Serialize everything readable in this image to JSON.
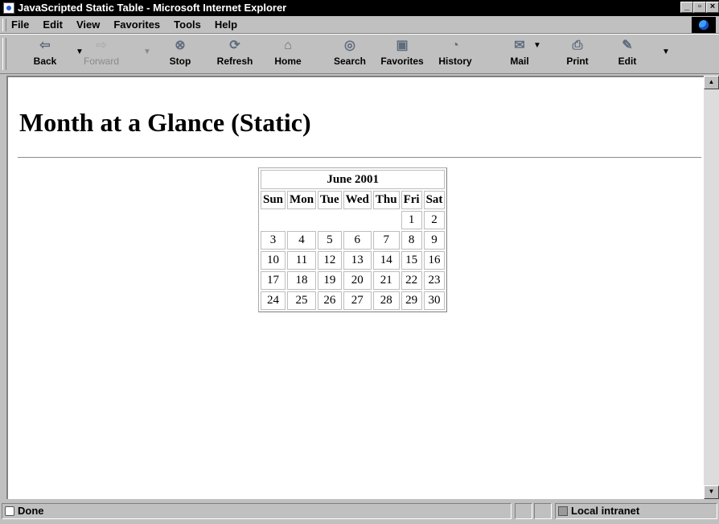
{
  "window": {
    "title": "JavaScripted Static Table - Microsoft Internet Explorer",
    "controls": [
      "_",
      "▫",
      "×"
    ]
  },
  "menu": [
    {
      "label": "File"
    },
    {
      "label": "Edit"
    },
    {
      "label": "View"
    },
    {
      "label": "Favorites"
    },
    {
      "label": "Tools"
    },
    {
      "label": "Help"
    }
  ],
  "toolbar": {
    "buttons": [
      {
        "label": "Back",
        "icon": "back-arrow-icon"
      },
      {
        "label": "Forward",
        "icon": "forward-arrow-icon",
        "disabled": true
      },
      {
        "label": "Stop",
        "icon": "stop-icon"
      },
      {
        "label": "Refresh",
        "icon": "refresh-icon"
      },
      {
        "label": "Home",
        "icon": "home-icon"
      },
      {
        "label": "Search",
        "icon": "search-icon"
      },
      {
        "label": "Favorites",
        "icon": "favorites-icon"
      },
      {
        "label": "History",
        "icon": "history-icon"
      },
      {
        "label": "Mail",
        "icon": "mail-icon"
      },
      {
        "label": "Print",
        "icon": "print-icon"
      },
      {
        "label": "Edit",
        "icon": "edit-icon"
      }
    ]
  },
  "page": {
    "heading": "Month at a Glance (Static)",
    "calendar": {
      "caption": "June 2001",
      "days": [
        "Sun",
        "Mon",
        "Tue",
        "Wed",
        "Thu",
        "Fri",
        "Sat"
      ],
      "weeks": [
        [
          "",
          "",
          "",
          "",
          "",
          "1",
          "2"
        ],
        [
          "3",
          "4",
          "5",
          "6",
          "7",
          "8",
          "9"
        ],
        [
          "10",
          "11",
          "12",
          "13",
          "14",
          "15",
          "16"
        ],
        [
          "17",
          "18",
          "19",
          "20",
          "21",
          "22",
          "23"
        ],
        [
          "24",
          "25",
          "26",
          "27",
          "28",
          "29",
          "30"
        ]
      ]
    }
  },
  "status": {
    "text": "Done",
    "zone": "Local intranet"
  },
  "colors": {
    "chrome": "#c0c0c0",
    "titlebar": "#000000",
    "page_background": "#ffffff"
  }
}
